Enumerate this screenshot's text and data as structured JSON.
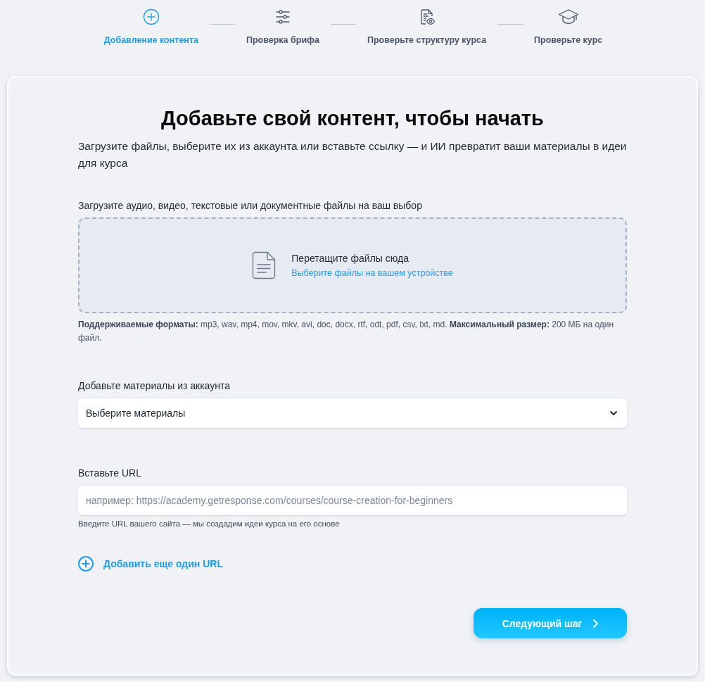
{
  "steps": [
    {
      "label": "Добавление контента",
      "selected": true
    },
    {
      "label": "Проверка брифа",
      "selected": false
    },
    {
      "label": "Проверьте структуру курса",
      "selected": false
    },
    {
      "label": "Проверьте курс",
      "selected": false
    }
  ],
  "card": {
    "title": "Добавьте свой контент, чтобы начать",
    "subtitle": "Загрузите файлы, выберите их из аккаунта или вставьте ссылку — и ИИ превратит ваши материалы в идеи для курса"
  },
  "upload": {
    "label": "Загрузите аудио, видео, текстовые или документные файлы на ваш выбор",
    "dropzone": {
      "text": "Перетащите файлы сюда",
      "link": "Выберите файлы на вашем устройстве"
    },
    "note": "**Поддерживаемые форматы:** mp3, wav, mp4, mov, mkv, avi, doc, docx, rtf, odt, pdf, csv, txt, md. **Максимальный размер:** 200 МБ на один файл."
  },
  "account_materials": {
    "label": "Добавьте материалы из аккаунта",
    "select": {
      "value": "Выберите материалы"
    }
  },
  "url": {
    "label": "Вставьте URL",
    "input": {
      "placeholder": "например: https://academy.getresponse.com/courses/course-creation-for-beginners"
    },
    "hint": "Введите URL вашего сайта — мы создадим идеи курса на его основе"
  },
  "add_url_link": "Добавить еще один URL",
  "next_button": "Следующий шаг"
}
